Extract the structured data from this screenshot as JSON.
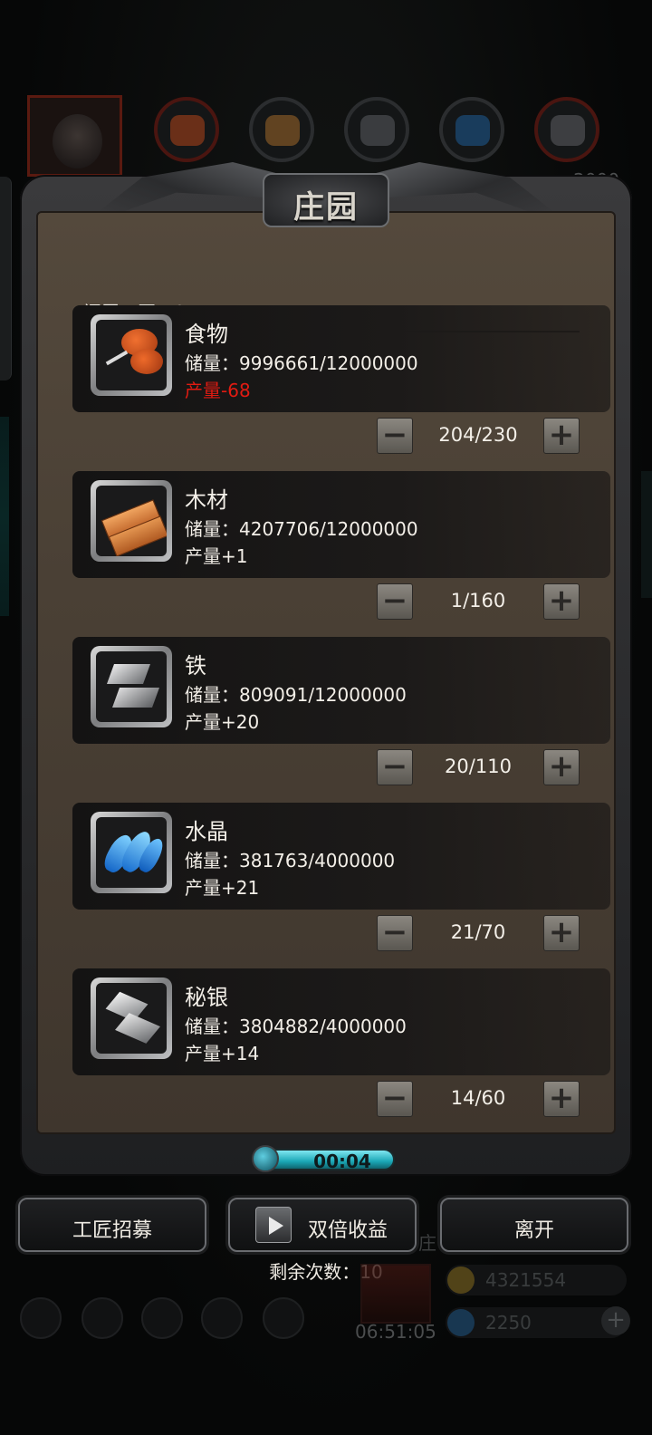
{
  "top_tabs": {
    "icons": [
      "avatar",
      "food-icon",
      "wood-icon",
      "iron-icon",
      "crystal-icon",
      "mithril-icon"
    ],
    "right_number": "2000"
  },
  "panel": {
    "title": "庄园",
    "idle_workers": "闲置工匠：0",
    "resources": [
      {
        "name": "食物",
        "storage": "储量：9996661/12000000",
        "production": "产量-68",
        "negative": true,
        "assigned": "204/230",
        "icon": "food-icon"
      },
      {
        "name": "木材",
        "storage": "储量：4207706/12000000",
        "production": "产量+1",
        "negative": false,
        "assigned": "1/160",
        "icon": "wood-icon"
      },
      {
        "name": "铁",
        "storage": "储量：809091/12000000",
        "production": "产量+20",
        "negative": false,
        "assigned": "20/110",
        "icon": "iron-icon"
      },
      {
        "name": "水晶",
        "storage": "储量：381763/4000000",
        "production": "产量+21",
        "negative": false,
        "assigned": "21/70",
        "icon": "crystal-icon"
      },
      {
        "name": "秘银",
        "storage": "储量：3804882/4000000",
        "production": "产量+14",
        "negative": false,
        "assigned": "14/60",
        "icon": "mithril-icon"
      }
    ],
    "minus": "−",
    "plus": "+"
  },
  "timer": {
    "text": "00:04"
  },
  "actions": {
    "recruit": "工匠招募",
    "double": "双倍收益",
    "leave": "离开",
    "remaining": "剩余次数：10"
  },
  "hud": {
    "side_label": "庄",
    "countdown": "06:51:05",
    "gold": "4321554",
    "gems": "2250",
    "colors": {
      "gold": "#b08a2a",
      "gem": "#2c8ad4",
      "accent": "#1ba7b6",
      "negative": "#e11b12"
    }
  }
}
